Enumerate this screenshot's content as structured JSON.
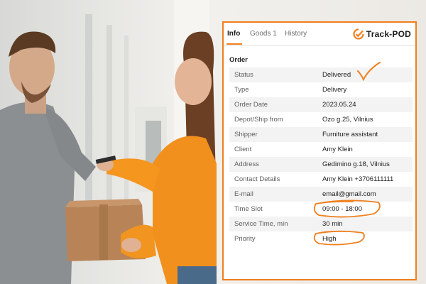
{
  "tabs": [
    {
      "label": "Info",
      "active": true
    },
    {
      "label": "Goods 1",
      "active": false
    },
    {
      "label": "History",
      "active": false
    }
  ],
  "brand": {
    "name": "Track-POD",
    "accent": "#f07f1d"
  },
  "section": {
    "title": "Order"
  },
  "rows": [
    {
      "label": "Status",
      "value": "Delivered"
    },
    {
      "label": "Type",
      "value": "Delivery"
    },
    {
      "label": "Order Date",
      "value": "2023.05.24"
    },
    {
      "label": "Depot/Ship from",
      "value": "Ozo g.25, Vilnius"
    },
    {
      "label": "Shipper",
      "value": "Furniture assistant"
    },
    {
      "label": "Client",
      "value": "Amy Klein"
    },
    {
      "label": "Address",
      "value": "Gedimino g.18, Vilnius"
    },
    {
      "label": "Contact Details",
      "value": "Amy Klein +3706111111"
    },
    {
      "label": "E-mail",
      "value": "email@gmail.com"
    },
    {
      "label": "Time Slot",
      "value": "09:00 - 18:00"
    },
    {
      "label": "Service Time, min",
      "value": "30 min"
    },
    {
      "label": "Priority",
      "value": "High"
    }
  ]
}
